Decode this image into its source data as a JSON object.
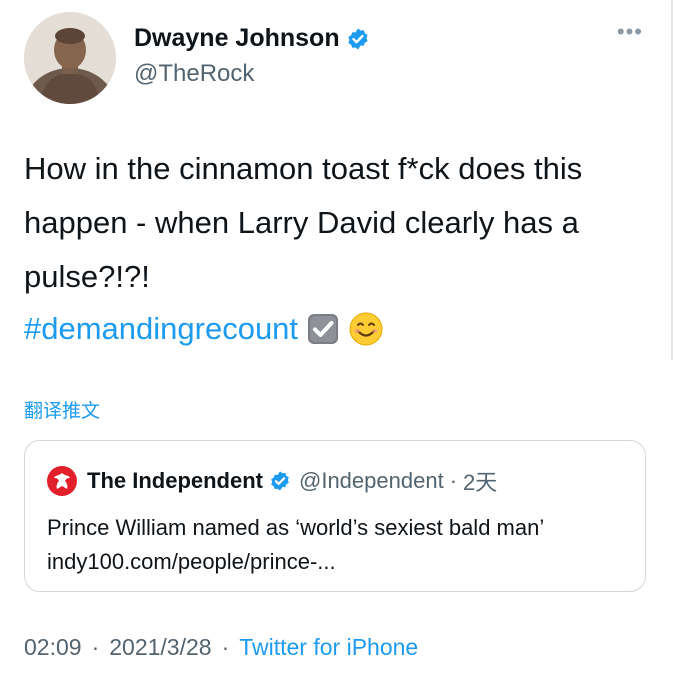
{
  "author": {
    "name": "Dwayne Johnson",
    "handle": "@TheRock"
  },
  "tweet": {
    "text": "How in the cinnamon toast f*ck does this happen - when Larry David clearly has a pulse?!?!",
    "hashtag": "#demandingrecount",
    "emojis": [
      "check-box-emoji",
      "smiling-face-emoji"
    ],
    "translate_label": "翻译推文"
  },
  "quoted_tweet": {
    "name": "The Independent",
    "handle": "@Independent",
    "separator": "·",
    "time": "2天",
    "text": "Prince William named as ‘world’s sexiest bald man’ indy100.com/people/prince-..."
  },
  "meta": {
    "time": "02:09",
    "separator": "·",
    "date": "2021/3/28",
    "source": "Twitter for iPhone"
  },
  "colors": {
    "link": "#1d9bf0",
    "secondary_text": "#536471",
    "primary_text": "#0f1419",
    "border": "#cfd9de",
    "independent_red": "#e2202c"
  }
}
